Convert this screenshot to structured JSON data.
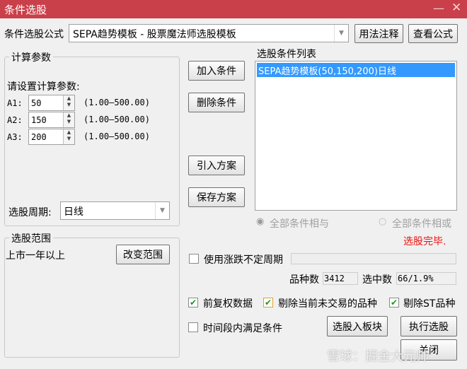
{
  "window": {
    "title": "条件选股",
    "minimize_icon": "minimize-icon",
    "close_icon": "close-icon"
  },
  "formula": {
    "label": "条件选股公式",
    "value": "SEPA趋势模板 - 股票魔法师选股模板",
    "usage_button": "用法注释",
    "view_button": "查看公式"
  },
  "params": {
    "group_label": "计算参数",
    "prompt": "请设置计算参数:",
    "items": [
      {
        "label": "A1:",
        "value": "50",
        "range": "(1.00—500.00)"
      },
      {
        "label": "A2:",
        "value": "150",
        "range": "(1.00—500.00)"
      },
      {
        "label": "A3:",
        "value": "200",
        "range": "(1.00—500.00)"
      }
    ],
    "period_label": "选股周期:",
    "period_value": "日线"
  },
  "actions": {
    "add": "加入条件",
    "delete": "删除条件",
    "import": "引入方案",
    "save": "保存方案"
  },
  "conditions": {
    "label": "选股条件列表",
    "items": [
      "SEPA趋势模板(50,150,200)日线"
    ],
    "and_label": "全部条件相与",
    "or_label": "全部条件相或",
    "status": "选股完毕."
  },
  "scope": {
    "group_label": "选股范围",
    "value": "上市一年以上",
    "change_button": "改变范围"
  },
  "options": {
    "variable_period": "使用涨跌不定周期",
    "count_label": "品种数",
    "count_value": "3412",
    "selected_label": "选中数",
    "selected_value": "66/1.9%",
    "adjusted": "前复权数据",
    "exclude_untraded": "剔除当前未交易的品种",
    "exclude_st": "剔除ST品种",
    "time_range": "时间段内满足条件"
  },
  "buttons": {
    "to_block": "选股入板块",
    "execute": "执行选股",
    "close": "关闭"
  },
  "watermark": "雪球：掘金大元帅"
}
